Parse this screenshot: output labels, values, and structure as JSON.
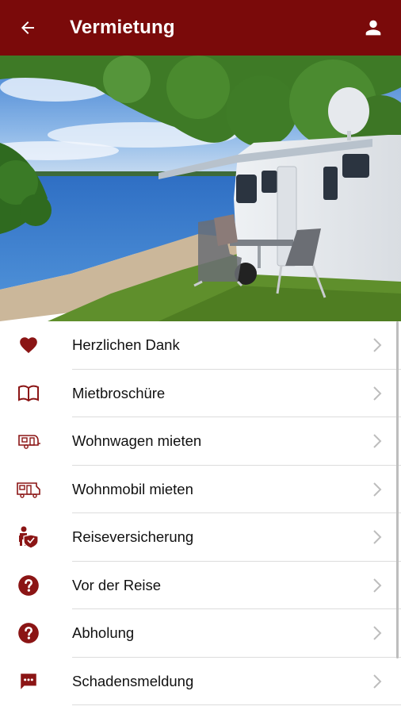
{
  "header": {
    "title": "Vermietung",
    "back_icon": "arrow-left-icon",
    "profile_icon": "person-icon"
  },
  "colors": {
    "brand": "#7a0a0a",
    "icon": "#8b1515",
    "chevron": "#bdbdbd"
  },
  "menu": {
    "items": [
      {
        "label": "Herzlichen Dank",
        "icon": "heart-icon"
      },
      {
        "label": "Mietbroschüre",
        "icon": "book-icon"
      },
      {
        "label": "Wohnwagen mieten",
        "icon": "caravan-icon"
      },
      {
        "label": "Wohnmobil mieten",
        "icon": "motorhome-icon"
      },
      {
        "label": "Reiseversicherung",
        "icon": "insurance-icon"
      },
      {
        "label": "Vor der Reise",
        "icon": "help-circle-icon"
      },
      {
        "label": "Abholung",
        "icon": "help-circle-icon"
      },
      {
        "label": "Schadensmeldung",
        "icon": "message-icon"
      }
    ]
  }
}
